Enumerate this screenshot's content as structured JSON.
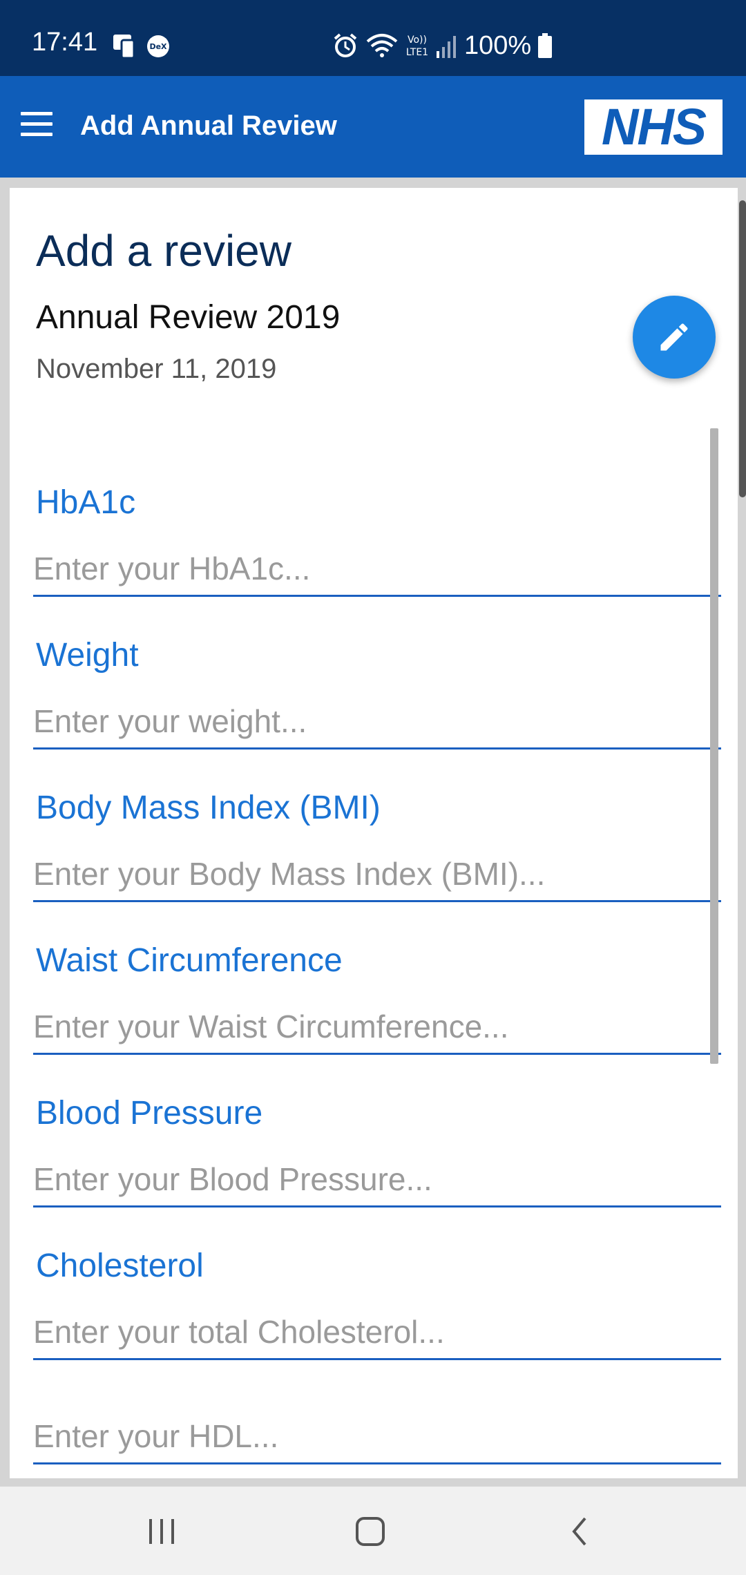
{
  "status_bar": {
    "time": "17:41",
    "battery": "100%",
    "icons": [
      "screen-mirror-icon",
      "dex-icon",
      "alarm-icon",
      "wifi-icon",
      "volte-icon",
      "signal-icon",
      "battery-icon"
    ]
  },
  "app_bar": {
    "title": "Add Annual Review",
    "logo_text": "NHS"
  },
  "review": {
    "heading": "Add a review",
    "name": "Annual Review 2019",
    "date": "November 11, 2019"
  },
  "fields": [
    {
      "label": "HbA1c",
      "placeholder": "Enter your HbA1c...",
      "value": ""
    },
    {
      "label": "Weight",
      "placeholder": "Enter your weight...",
      "value": ""
    },
    {
      "label": "Body Mass Index (BMI)",
      "placeholder": "Enter your Body Mass Index (BMI)...",
      "value": ""
    },
    {
      "label": "Waist Circumference",
      "placeholder": "Enter your Waist Circumference...",
      "value": ""
    },
    {
      "label": "Blood Pressure",
      "placeholder": "Enter your Blood Pressure...",
      "value": ""
    },
    {
      "label": "Cholesterol",
      "placeholder": "Enter your total Cholesterol...",
      "value": ""
    }
  ],
  "extra_field": {
    "placeholder": "Enter your HDL...",
    "value": ""
  },
  "colors": {
    "status_bar": "#073064",
    "app_bar": "#0f5db9",
    "label": "#1a73d4",
    "fab": "#1e88e5"
  },
  "nav": {
    "icons": [
      "recent-apps-icon",
      "home-icon",
      "back-icon"
    ]
  }
}
